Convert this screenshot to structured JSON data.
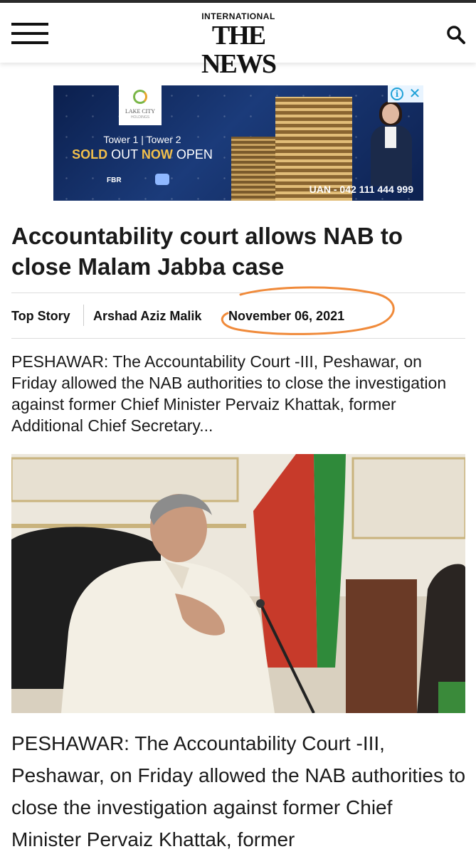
{
  "header": {
    "logo_top": "INTERNATIONAL",
    "logo_main": "THE NEWS",
    "menu_icon": "hamburger-menu-icon",
    "search_icon": "search-icon"
  },
  "ad": {
    "brand": "LAKE CITY",
    "brand_sub": "HOLDINGS",
    "line1": "Tower 1 | Tower 2",
    "sold": "SOLD",
    "out": " OUT ",
    "now": "NOW",
    "open": " OPEN",
    "fbr": "FBR",
    "uan": "UAN - 042 111 444 999",
    "info_icon": "ad-info-icon",
    "close_icon": "ad-close-icon",
    "colors": {
      "background": "#0b1f4d",
      "gold": "#f3c04b",
      "info": "#1ea1d8"
    }
  },
  "article": {
    "headline": "Accountability court allows NAB to close Malam Jabba case",
    "category": "Top Story",
    "author": "Arshad Aziz Malik",
    "date": "November 06, 2021",
    "summary": "PESHAWAR: The Accountability Court -III, Peshawar, on Friday allowed the NAB authorities to close the investigation against former Chief Minister Pervaiz Khattak, former Additional Chief Secretary...",
    "body": "PESHAWAR: The Accountability Court -III, Peshawar, on Friday allowed the NAB authorities to close the investigation against former Chief Minister Pervaiz Khattak, former"
  },
  "annotation": {
    "color": "#f08a3a"
  }
}
